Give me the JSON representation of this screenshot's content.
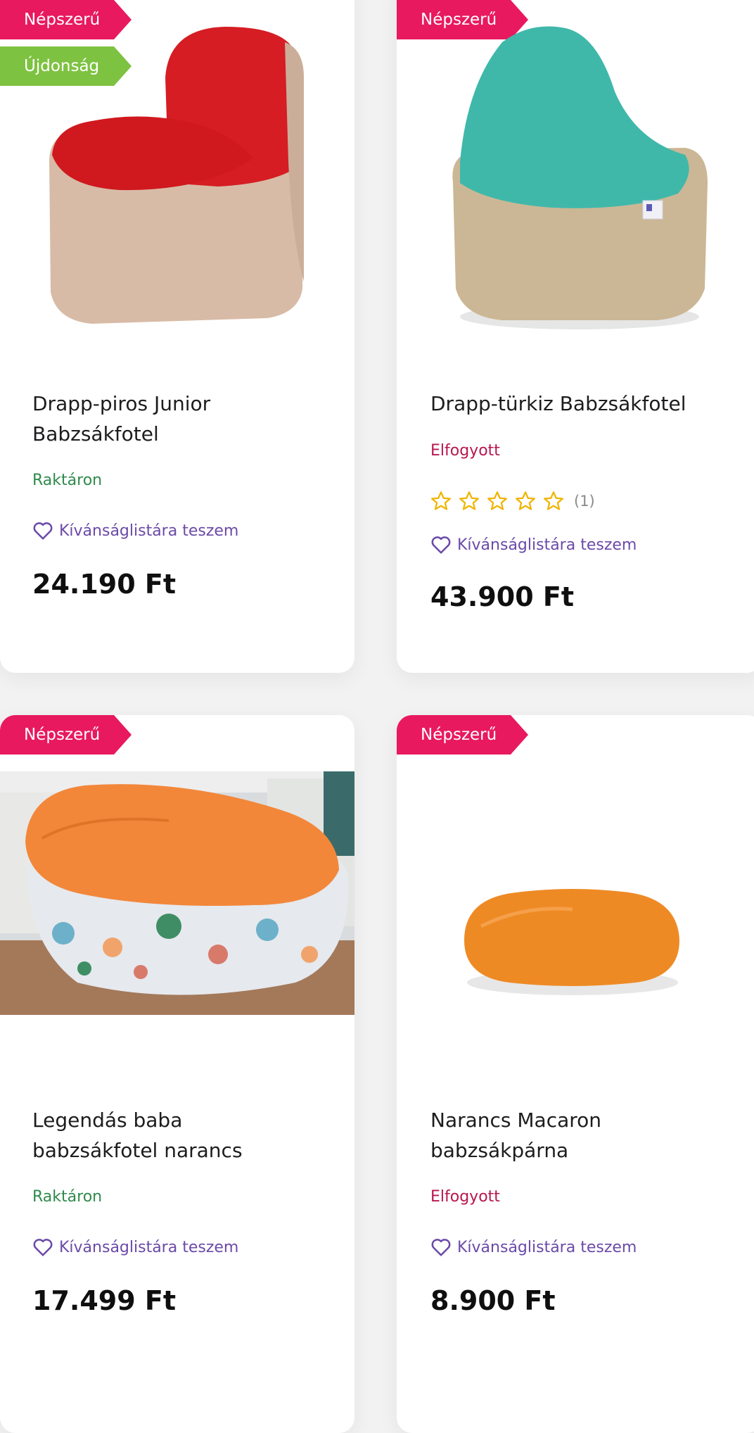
{
  "badges": {
    "popular": "Népszerű",
    "new": "Újdonság"
  },
  "wishlist_label": "Kívánságlistára teszem",
  "products": [
    {
      "title_line1": "Drapp-piros Junior",
      "title_line2": "Babzsákfotel",
      "stock": "Raktáron",
      "price": "24.190 Ft"
    },
    {
      "title_line1": "Drapp-türkiz Babzsákfotel",
      "title_line2": "",
      "stock": "Elfogyott",
      "rating_count": "(1)",
      "price": "43.900 Ft"
    },
    {
      "title_line1": "Legendás baba",
      "title_line2": "babzsákfotel narancs",
      "stock": "Raktáron",
      "price": "17.499 Ft"
    },
    {
      "title_line1": "Narancs Macaron",
      "title_line2": "babzsákpárna",
      "stock": "Elfogyott",
      "price": "8.900 Ft"
    }
  ],
  "colors": {
    "popular_badge": "#e8195f",
    "new_badge": "#7ec241",
    "in_stock": "#2f8a4c",
    "out_of_stock": "#b8164f",
    "wishlist": "#6b4aa8"
  }
}
